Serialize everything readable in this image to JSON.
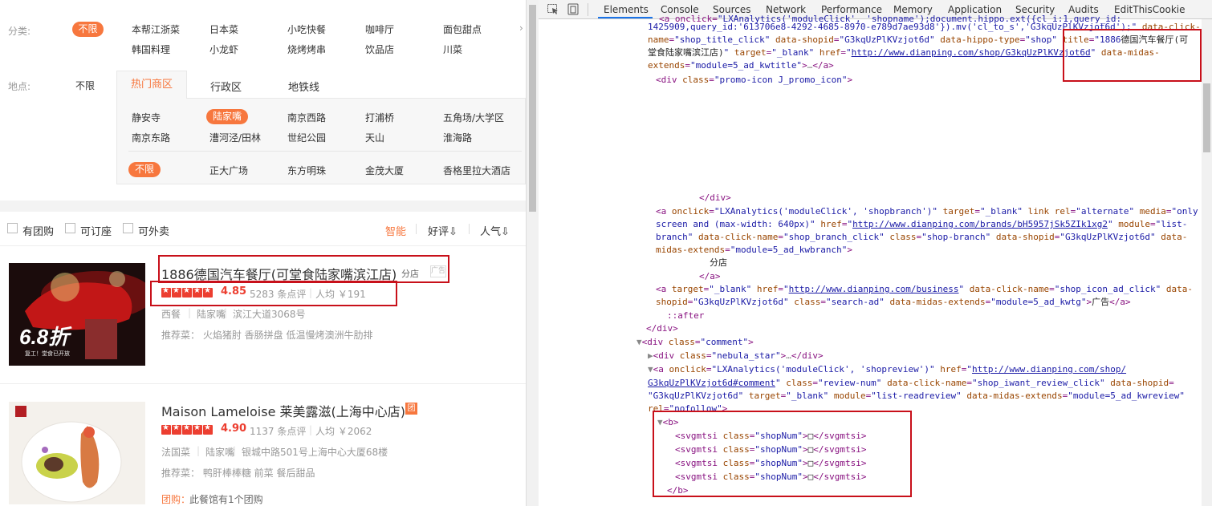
{
  "filters": {
    "category_label": "分类:",
    "category_active": "不限",
    "category_options_row1": [
      "本帮江浙菜",
      "日本菜",
      "小吃快餐",
      "咖啡厅",
      "面包甜点"
    ],
    "category_options_row2": [
      "韩国料理",
      "小龙虾",
      "烧烤烤串",
      "饮品店",
      "川菜"
    ],
    "location_label": "地点:",
    "location_any": "不限",
    "location_tabs": [
      "热门商区",
      "行政区",
      "地铁线"
    ],
    "hot_districts_row1": [
      "静安寺",
      "陆家嘴",
      "南京西路",
      "打浦桥",
      "五角场/大学区"
    ],
    "hot_districts_row2": [
      "南京东路",
      "漕河泾/田林",
      "世纪公园",
      "天山",
      "淮海路"
    ],
    "hot_districts_row3_active": "不限",
    "hot_districts_row3": [
      "正大广场",
      "东方明珠",
      "金茂大厦",
      "香格里拉大酒店"
    ]
  },
  "toolbar": {
    "checkboxes": [
      "有团购",
      "可订座",
      "可外卖"
    ],
    "sorts": [
      "智能",
      "好评⇩",
      "人气⇩"
    ]
  },
  "shops": [
    {
      "name": "1886德国汽车餐厅(可堂食陆家嘴滨江店)",
      "branch_badge": "分店",
      "ad_badge": "广告",
      "score": "4.85",
      "reviews": "5283 条点评",
      "avg_price": "人均 ￥191",
      "cuisine": "西餐",
      "district": "陆家嘴",
      "address": "滨江大道3068号",
      "recommend": "推荐菜：  火焰猪肘  香肠拼盘  低温慢烤澳洲牛肋排",
      "image_text": "6.8折",
      "image_subtext": "复工！堂食已开放"
    },
    {
      "name": "Maison Lameloise 莱美露滋(上海中心店)",
      "group_badge": "团",
      "score": "4.90",
      "reviews": "1137 条点评",
      "avg_price": "人均 ￥2062",
      "cuisine": "法国菜",
      "district": "陆家嘴",
      "address": "银城中路501号上海中心大厦68楼",
      "recommend": "推荐菜：  鸭肝棒棒糖  前菜  餐后甜品",
      "group_deal_label": "团购：",
      "group_deal_text": "此餐馆有1个团购"
    }
  ],
  "devtools": {
    "tabs": [
      "Elements",
      "Console",
      "Sources",
      "Network",
      "Performance",
      "Memory",
      "Application",
      "Security",
      "Audits",
      "EditThisCookie"
    ],
    "active_tab": "Elements"
  },
  "colors": {
    "accent_orange": "#f7773e",
    "star_red": "#ec3e30",
    "annotation_red": "#c8101a",
    "devtools_blue": "#1a73e8"
  }
}
